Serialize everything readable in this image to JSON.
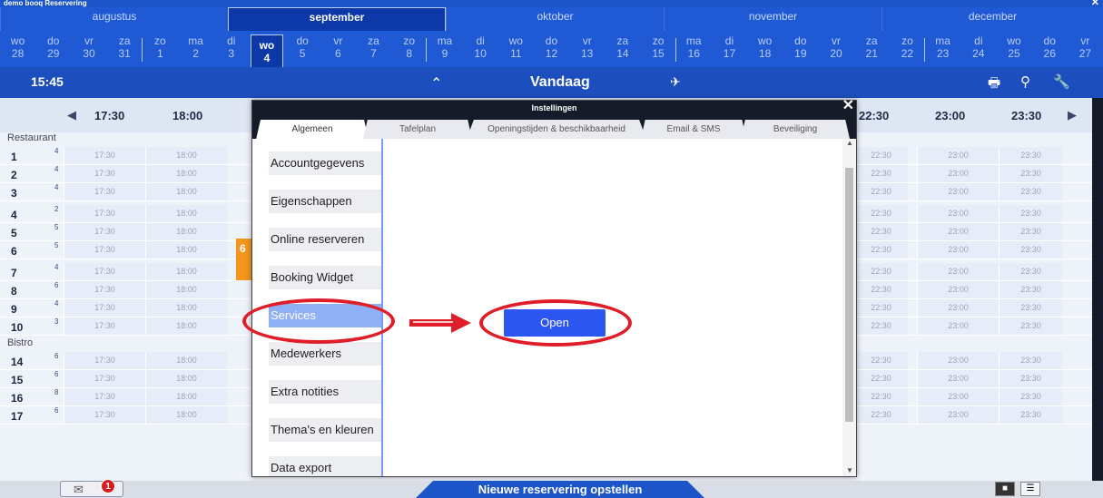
{
  "app": {
    "title": "demo booq Reservering",
    "close": "✕"
  },
  "months": [
    {
      "label": "augustus",
      "active": false
    },
    {
      "label": "september",
      "active": true
    },
    {
      "label": "oktober",
      "active": false
    },
    {
      "label": "november",
      "active": false
    },
    {
      "label": "december",
      "active": false
    }
  ],
  "days": [
    {
      "d": "wo",
      "n": "28"
    },
    {
      "d": "do",
      "n": "29"
    },
    {
      "d": "vr",
      "n": "30"
    },
    {
      "d": "za",
      "n": "31"
    },
    {
      "d": "zo",
      "n": "1"
    },
    {
      "d": "ma",
      "n": "2"
    },
    {
      "d": "di",
      "n": "3"
    },
    {
      "d": "wo",
      "n": "4",
      "active": true
    },
    {
      "d": "do",
      "n": "5"
    },
    {
      "d": "vr",
      "n": "6"
    },
    {
      "d": "za",
      "n": "7"
    },
    {
      "d": "zo",
      "n": "8"
    },
    {
      "d": "ma",
      "n": "9"
    },
    {
      "d": "di",
      "n": "10"
    },
    {
      "d": "wo",
      "n": "11"
    },
    {
      "d": "do",
      "n": "12"
    },
    {
      "d": "vr",
      "n": "13"
    },
    {
      "d": "za",
      "n": "14"
    },
    {
      "d": "zo",
      "n": "15"
    },
    {
      "d": "ma",
      "n": "16"
    },
    {
      "d": "di",
      "n": "17"
    },
    {
      "d": "wo",
      "n": "18"
    },
    {
      "d": "do",
      "n": "19"
    },
    {
      "d": "vr",
      "n": "20"
    },
    {
      "d": "za",
      "n": "21"
    },
    {
      "d": "zo",
      "n": "22"
    },
    {
      "d": "ma",
      "n": "23"
    },
    {
      "d": "di",
      "n": "24"
    },
    {
      "d": "wo",
      "n": "25"
    },
    {
      "d": "do",
      "n": "26"
    },
    {
      "d": "vr",
      "n": "27"
    }
  ],
  "toolbar": {
    "time": "15:45",
    "collapse": "⌃",
    "today": "Vandaag",
    "pin": "✈",
    "print": "🖶",
    "search": "⚲",
    "tools": "🔧"
  },
  "timeline": {
    "prev": "◀",
    "next": "▶",
    "left_times": [
      "17:30",
      "18:00"
    ],
    "right_times": [
      "22:30",
      "23:00",
      "23:30"
    ]
  },
  "sections": [
    {
      "name": "Restaurant",
      "rows": [
        {
          "no": "1",
          "cap": "4"
        },
        {
          "no": "2",
          "cap": "4"
        },
        {
          "no": "3",
          "cap": "4"
        },
        {
          "no": "4",
          "cap": "2"
        },
        {
          "no": "5",
          "cap": "5"
        },
        {
          "no": "6",
          "cap": "5"
        },
        {
          "no": "7",
          "cap": "4"
        },
        {
          "no": "8",
          "cap": "6"
        },
        {
          "no": "9",
          "cap": "4"
        },
        {
          "no": "10",
          "cap": "3"
        }
      ]
    },
    {
      "name": "Bistro",
      "rows": [
        {
          "no": "14",
          "cap": "6"
        },
        {
          "no": "15",
          "cap": "6"
        },
        {
          "no": "16",
          "cap": "8"
        },
        {
          "no": "17",
          "cap": "6"
        }
      ]
    }
  ],
  "cell_times": [
    "17:30",
    "18:00",
    "22:30",
    "23:00",
    "23:30"
  ],
  "reservation": {
    "label": "6"
  },
  "dialog": {
    "title": "Instellingen",
    "close": "✕",
    "tabs": [
      "Algemeen",
      "Tafelplan",
      "Openingstijden & beschikbaarheid",
      "Email & SMS",
      "Beveiliging"
    ],
    "menu": [
      "Accountgegevens",
      "Eigenschappen",
      "Online reserveren",
      "Booking Widget",
      "Services",
      "Medewerkers",
      "Extra notities",
      "Thema's en kleuren",
      "Data export"
    ],
    "selected": "Services",
    "open_label": "Open",
    "scroll_up": "▲",
    "scroll_down": "▼"
  },
  "footer": {
    "new_reservation": "Nieuwe reservering opstellen",
    "mail_badge": "1",
    "mail_icon": "✉",
    "view_grid": "■",
    "view_list": "☰"
  },
  "colors": {
    "primary": "#1f5ad4",
    "active": "#0c38a8",
    "selection": "#8fb0f5",
    "open_button": "#2b57f0",
    "annotation": "#e01e2a",
    "reservation": "#f2961e"
  }
}
